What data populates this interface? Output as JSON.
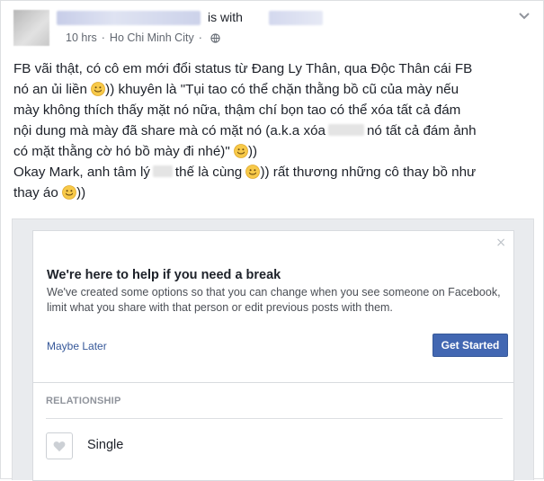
{
  "post": {
    "is_with": "is with",
    "time": "10 hrs",
    "separator": "·",
    "location": "Ho Chi Minh City",
    "icons": [
      "globe-icon",
      "chevron-down-icon"
    ]
  },
  "status": {
    "line1": "FB vãi thật, có cô em mới đổi status từ Đang Ly Thân, qua Độc Thân cái FB",
    "line2a": "nó an ủi liền",
    "line2b": ")) khuyên là \"Tụi tao có thể chặn thằng bồ cũ của mày nếu",
    "line3": "mày không thích thấy mặt nó nữa, thậm chí bọn tao có thể xóa tất cả đám",
    "line4a": "nội dung mà mày đã share mà có mặt nó (a.k.a xóa",
    "line4b": "nó tất cả đám ảnh",
    "line5a": "có mặt thằng cờ hó bồ mày đi nhé)\"",
    "line5b": "))",
    "line6a": "Okay Mark, anh tâm lý",
    "line6b": "thế là cùng",
    "line6c": ")) rất thương những cô thay bồ như",
    "line7a": "thay áo",
    "line7b": "))",
    "emoji": "smile-emoji-icon"
  },
  "card": {
    "close": "×",
    "title": "We're here to help if you need a break",
    "description": "We've created some options so that you can change when you see someone on Facebook, limit what you share with that person or edit previous posts with them.",
    "maybe_later": "Maybe Later",
    "get_started": "Get Started"
  },
  "relationship": {
    "section_title": "RELATIONSHIP",
    "status": "Single",
    "icon": "heart-icon"
  },
  "colors": {
    "link": "#365899",
    "button": "#4267b2",
    "muted": "#90949c"
  }
}
